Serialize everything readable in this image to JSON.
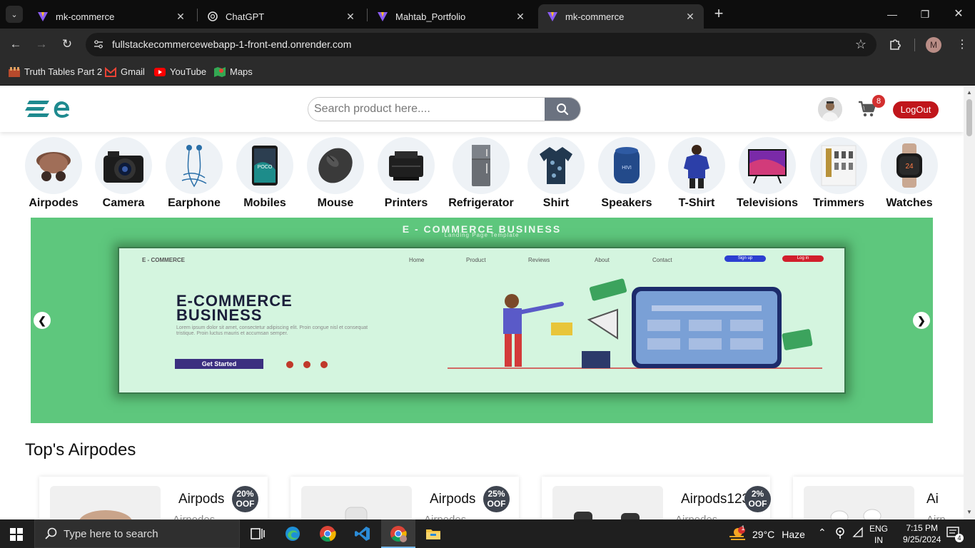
{
  "browser": {
    "tabs": [
      {
        "title": "mk-commerce",
        "active": false
      },
      {
        "title": "ChatGPT",
        "active": false
      },
      {
        "title": "Mahtab_Portfolio",
        "active": false
      },
      {
        "title": "mk-commerce",
        "active": true
      }
    ],
    "url": "fullstackecommercewebapp-1-front-end.onrender.com",
    "profile_initial": "M",
    "bookmarks": [
      {
        "label": "Truth Tables Part 2",
        "icon": "bookmark-site-icon"
      },
      {
        "label": "Gmail",
        "icon": "gmail-icon"
      },
      {
        "label": "YouTube",
        "icon": "youtube-icon"
      },
      {
        "label": "Maps",
        "icon": "maps-icon"
      }
    ]
  },
  "site": {
    "search_placeholder": "Search product here....",
    "cart_count": "8",
    "logout_label": "LogOut",
    "accent_color": "#c0161b"
  },
  "categories": [
    {
      "label": "Airpodes",
      "icon": "airpods-icon"
    },
    {
      "label": "Camera",
      "icon": "camera-icon"
    },
    {
      "label": "Earphone",
      "icon": "earphone-icon"
    },
    {
      "label": "Mobiles",
      "icon": "mobile-icon"
    },
    {
      "label": "Mouse",
      "icon": "mouse-icon"
    },
    {
      "label": "Printers",
      "icon": "printer-icon"
    },
    {
      "label": "Refrigerator",
      "icon": "refrigerator-icon"
    },
    {
      "label": "Shirt",
      "icon": "shirt-icon"
    },
    {
      "label": "Speakers",
      "icon": "speaker-icon"
    },
    {
      "label": "T-Shirt",
      "icon": "tshirt-icon"
    },
    {
      "label": "Televisions",
      "icon": "television-icon"
    },
    {
      "label": "Trimmers",
      "icon": "trimmer-icon"
    },
    {
      "label": "Watches",
      "icon": "watch-icon"
    }
  ],
  "banner": {
    "title": "E - COMMERCE BUSINESS",
    "subtitle": "Landing Page Template",
    "mock_brand": "E - COMMERCE",
    "mock_nav": [
      "Home",
      "Product",
      "Reviews",
      "About",
      "Contact"
    ],
    "mock_signup": "Sign up",
    "mock_login": "Log in",
    "headline_1": "E-COMMERCE",
    "headline_2": "BUSINESS",
    "lorem": "Lorem ipsum dolor sit amet, consectetur adipiscing elit. Proin congue nisl et consequat tristique. Proin luctus mauris et accumsan semper.",
    "cta": "Get Started",
    "bg_color": "#5ec77d"
  },
  "section": {
    "title": "Top's Airpodes"
  },
  "products": [
    {
      "name": "Airpods",
      "category": "Airpodes",
      "off": "20%",
      "off_label": "OOF"
    },
    {
      "name": "Airpods",
      "category": "Airpodes",
      "off": "25%",
      "off_label": "OOF"
    },
    {
      "name": "Airpods123",
      "category": "Airpodes",
      "off": "2%",
      "off_label": "OOF"
    },
    {
      "name": "Ai",
      "category": "Airp",
      "off": "",
      "off_label": ""
    }
  ],
  "taskbar": {
    "search_placeholder": "Type here to search",
    "weather_temp": "29°C",
    "weather_text": "Haze",
    "weather_badge": "1",
    "lang_1": "ENG",
    "lang_2": "IN",
    "time": "7:15 PM",
    "date": "9/25/2024",
    "notif_count": "4"
  }
}
